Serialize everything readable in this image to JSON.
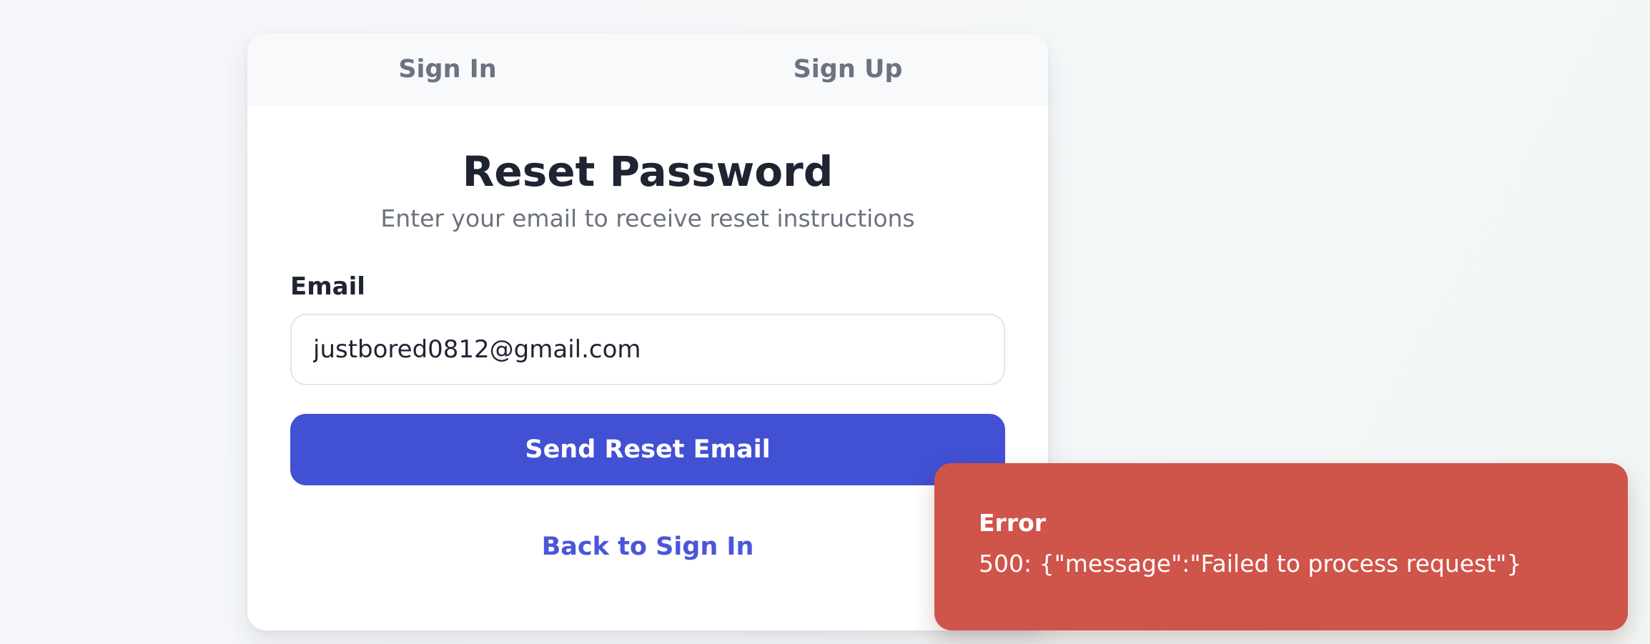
{
  "tabs": [
    {
      "label": "Sign In"
    },
    {
      "label": "Sign Up"
    }
  ],
  "form": {
    "title": "Reset Password",
    "subtitle": "Enter your email to receive reset instructions",
    "email_label": "Email",
    "email_value": "justbored0812@gmail.com",
    "submit_label": "Send Reset Email",
    "back_link": "Back to Sign In"
  },
  "toast": {
    "title": "Error",
    "message": "500: {\"message\":\"Failed to process request\"}"
  },
  "colors": {
    "primary": "#4250d3",
    "link": "#4a57d9",
    "error": "#cf544a"
  }
}
